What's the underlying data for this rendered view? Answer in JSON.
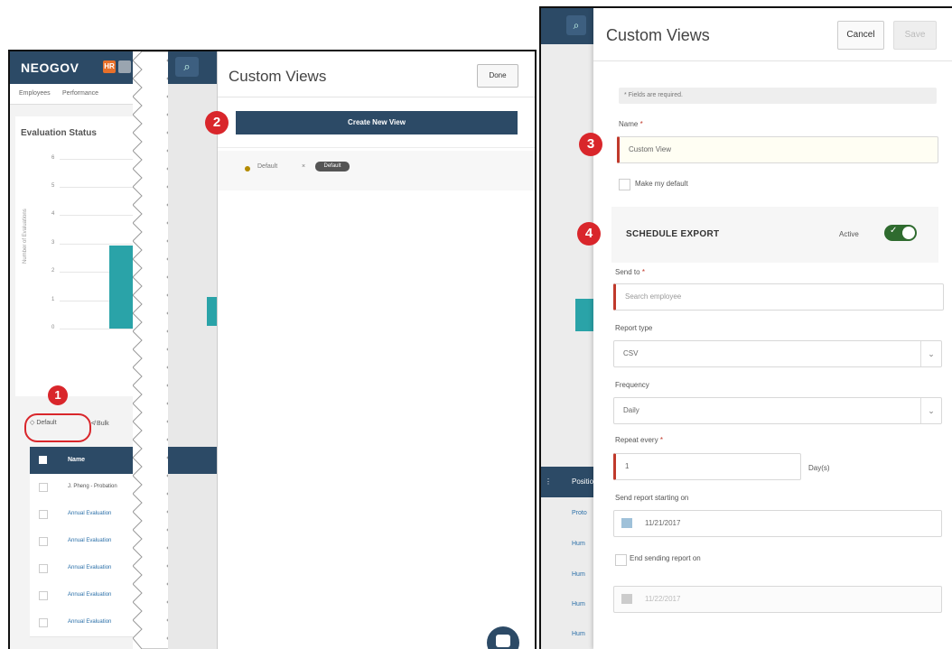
{
  "left": {
    "app": {
      "brand": "NEOGOV",
      "brand_badge": "HR",
      "subnav": [
        "Employees",
        "Performance"
      ],
      "card_title": "Evaluation Status",
      "y_axis_label": "Number of Evaluations",
      "y_ticks": [
        "6",
        "5",
        "4",
        "3",
        "2",
        "1",
        "0"
      ],
      "default_button": "Default",
      "bulk_button": "Bulk",
      "table_header": "Name",
      "rows": [
        "J. Pheng - Probation",
        "Annual Evaluation",
        "Annual Evaluation",
        "Annual Evaluation",
        "Annual Evaluation",
        "Annual Evaluation"
      ]
    },
    "panel": {
      "title": "Custom Views",
      "done_label": "Done",
      "create_label": "Create New View",
      "view_name": "Default",
      "view_tag": "Default"
    },
    "callouts": {
      "one": "1",
      "two": "2"
    }
  },
  "right": {
    "bg": {
      "col_header": "Position",
      "rows": [
        "Proto",
        "Hum",
        "Hum",
        "Hum",
        "Hum",
        "Hum"
      ]
    },
    "panel": {
      "title": "Custom Views",
      "cancel_label": "Cancel",
      "save_label": "Save",
      "required_note": "* Fields are required.",
      "name_label": "Name",
      "name_value": "Custom View",
      "make_default_label": "Make my default",
      "schedule_title": "SCHEDULE EXPORT",
      "active_label": "Active",
      "send_to_label": "Send to",
      "send_to_placeholder": "Search employee",
      "report_type_label": "Report type",
      "report_type_value": "CSV",
      "frequency_label": "Frequency",
      "frequency_value": "Daily",
      "repeat_label": "Repeat every",
      "repeat_value": "1",
      "repeat_unit": "Day(s)",
      "start_label": "Send report starting on",
      "start_value": "11/21/2017",
      "end_label": "End sending report on",
      "end_value": "11/22/2017"
    },
    "callouts": {
      "three": "3",
      "four": "4"
    }
  },
  "colors": {
    "navy": "#2c4a66",
    "teal": "#2aa3a8",
    "callout_red": "#d9262b",
    "required_red": "#c0392b",
    "toggle_green": "#2f6b2f"
  }
}
